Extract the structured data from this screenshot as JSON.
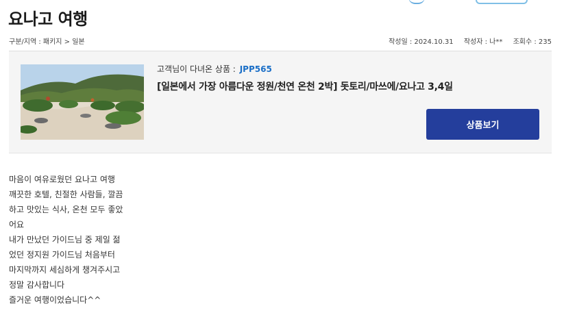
{
  "page": {
    "title": "요나고 여행"
  },
  "meta": {
    "category": "구분/지역 : 패키지 > 일본",
    "date": "작성일 : 2024.10.31",
    "author": "작성자 : 나**",
    "views": "조회수 : 235"
  },
  "product": {
    "customer_label": "고객님이 다녀온 상품 :",
    "code": "JPP565",
    "name": "[일본에서 가장 아름다운 정원/천연 온천 2박] 돗토리/마쓰에/요나고 3,4일",
    "view_button": "상품보기"
  },
  "review": {
    "lines": [
      "마음이 여유로웠던 요나고 여행",
      "깨끗한 호텔, 친절한 사람들, 깔끔",
      "하고 맛있는 식사, 온천 모두 좋았",
      "어요",
      "내가 만났던 가이드님 중 제일 젊",
      "었던 정지원 가이드님 처음부터",
      "마지막까지 세심하게 챙겨주시고",
      "정말 감사합니다",
      "즐거운 여행이었습니다^^"
    ]
  }
}
